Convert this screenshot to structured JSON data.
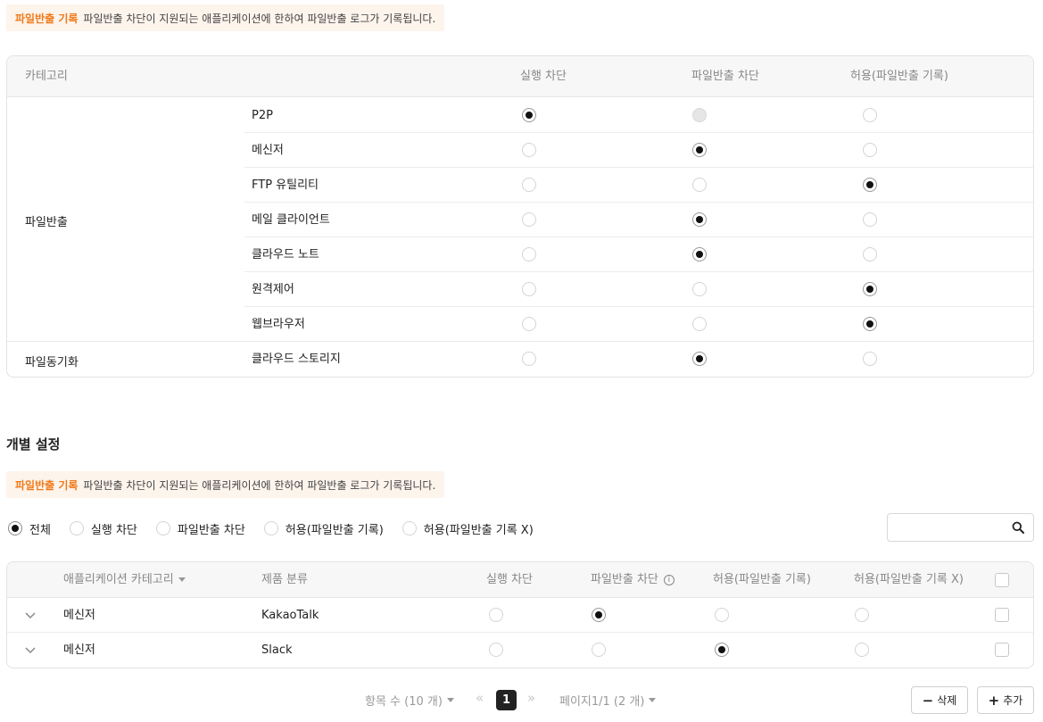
{
  "notice": {
    "tag": "파일반출 기록",
    "text": "파일반출 차단이 지원되는 애플리케이션에 한하여 파일반출 로그가 기록됩니다."
  },
  "category_table": {
    "headers": {
      "category": "카테고리",
      "block_exec": "실행 차단",
      "block_export": "파일반출 차단",
      "allow_log": "허용(파일반출 기록)"
    },
    "groups": [
      {
        "label": "파일반출"
      },
      {
        "label": "파일동기화"
      }
    ],
    "rows": [
      {
        "name": "P2P",
        "selected": "block_exec",
        "disabled": [
          "block_export"
        ]
      },
      {
        "name": "메신저",
        "selected": "block_export",
        "disabled": []
      },
      {
        "name": "FTP 유틸리티",
        "selected": "allow_log",
        "disabled": []
      },
      {
        "name": "메일 클라이언트",
        "selected": "block_export",
        "disabled": []
      },
      {
        "name": "클라우드 노트",
        "selected": "block_export",
        "disabled": []
      },
      {
        "name": "원격제어",
        "selected": "allow_log",
        "disabled": []
      },
      {
        "name": "웹브라우저",
        "selected": "allow_log",
        "disabled": []
      },
      {
        "name": "클라우드 스토리지",
        "selected": "block_export",
        "disabled": []
      }
    ]
  },
  "individual": {
    "title": "개별 설정",
    "notice": {
      "tag": "파일반출 기록",
      "text": "파일반출 차단이 지원되는 애플리케이션에 한하여 파일반출 로그가 기록됩니다."
    },
    "filters": [
      {
        "label": "전체",
        "selected": true
      },
      {
        "label": "실행 차단",
        "selected": false
      },
      {
        "label": "파일반출 차단",
        "selected": false
      },
      {
        "label": "허용(파일반출 기록)",
        "selected": false
      },
      {
        "label": "허용(파일반출 기록 X)",
        "selected": false
      }
    ],
    "search": {
      "placeholder": "",
      "icon": "search-icon"
    },
    "headers": {
      "category": "애플리케이션 카테고리",
      "product": "제품 분류",
      "block_exec": "실행 차단",
      "block_export": "파일반출 차단",
      "allow_log": "허용(파일반출 기록)",
      "allow_nolog": "허용(파일반출 기록 X)"
    },
    "rows": [
      {
        "category": "메신저",
        "product": "KakaoTalk",
        "selected": "block_export"
      },
      {
        "category": "메신저",
        "product": "Slack",
        "selected": "allow_log"
      }
    ]
  },
  "pagination": {
    "items_label": "항목 수 (10 개)",
    "current_page": "1",
    "page_info": "페이지1/1 (2 개)"
  },
  "buttons": {
    "delete": "삭제",
    "add": "추가"
  }
}
